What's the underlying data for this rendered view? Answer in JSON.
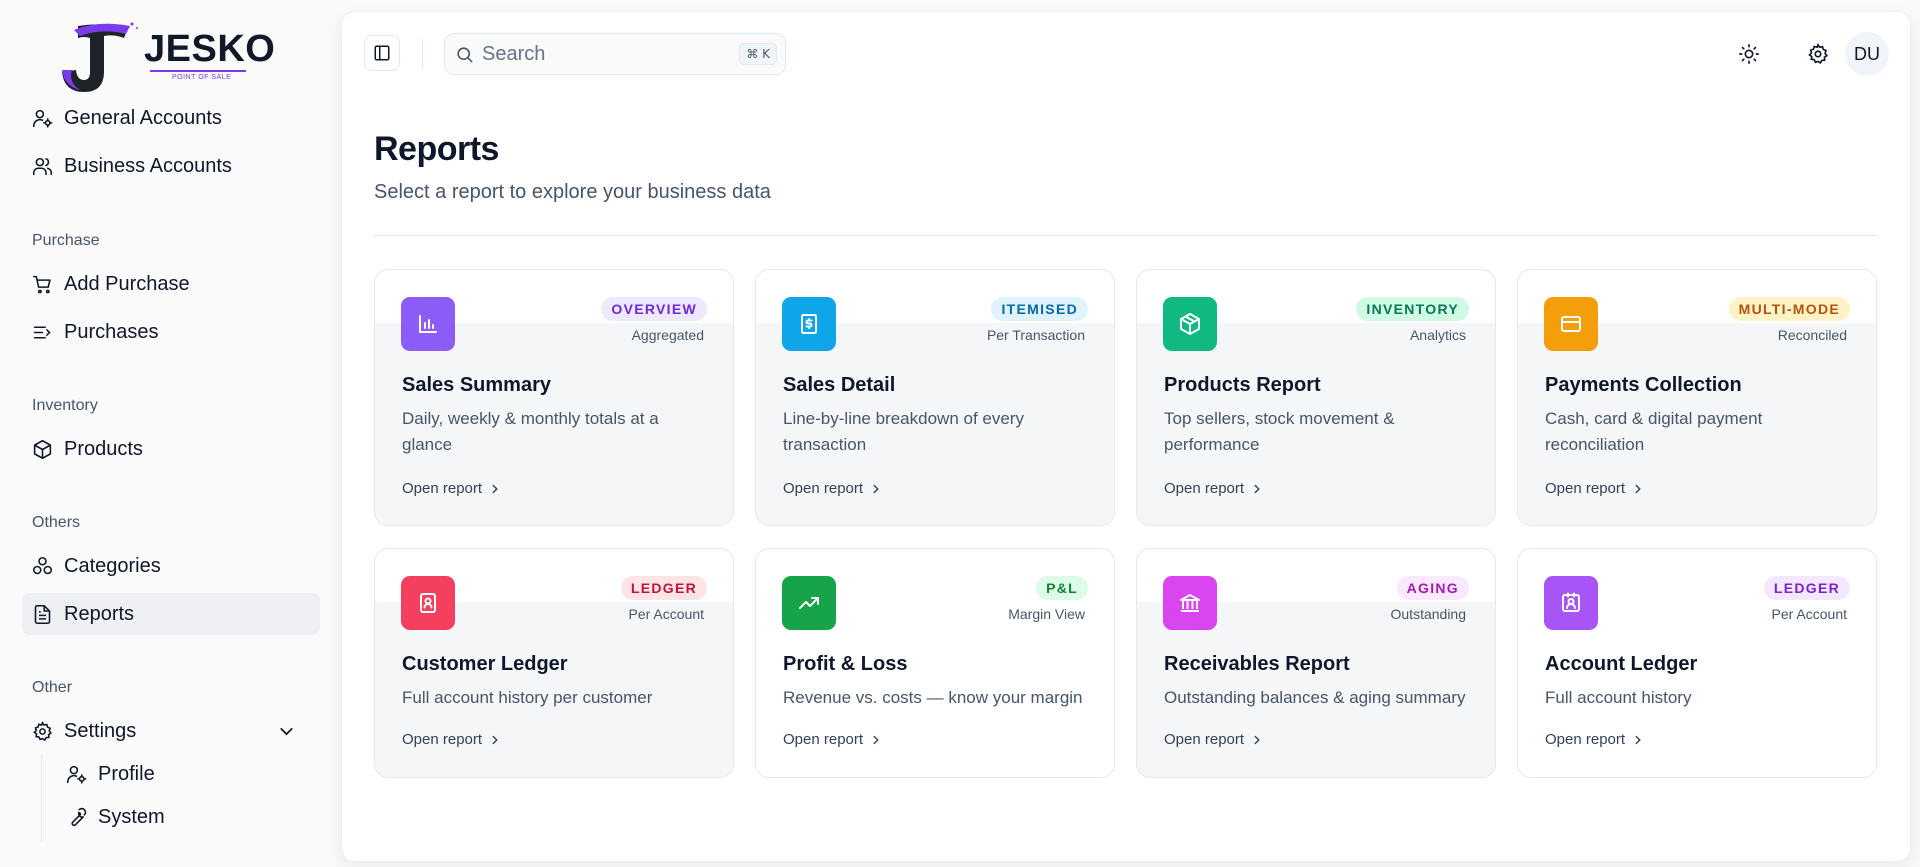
{
  "brand": {
    "name": "JESKO",
    "tagline": "POINT OF SALE",
    "accent": "#7c3aed"
  },
  "sidebar": {
    "top_items": [
      {
        "label": "General Accounts",
        "icon": "user-cog-icon"
      },
      {
        "label": "Business Accounts",
        "icon": "users-icon"
      }
    ],
    "sections": [
      {
        "title": "Purchase",
        "items": [
          {
            "label": "Add Purchase",
            "icon": "cart-icon"
          },
          {
            "label": "Purchases",
            "icon": "list-icon"
          }
        ]
      },
      {
        "title": "Inventory",
        "items": [
          {
            "label": "Products",
            "icon": "box-icon"
          }
        ]
      },
      {
        "title": "Others",
        "items": [
          {
            "label": "Categories",
            "icon": "categories-icon"
          },
          {
            "label": "Reports",
            "icon": "file-text-icon",
            "active": true
          }
        ]
      },
      {
        "title": "Other",
        "items": [
          {
            "label": "Settings",
            "icon": "gear-icon"
          }
        ]
      }
    ],
    "settings_children": [
      {
        "label": "Profile",
        "icon": "user-cog-icon"
      },
      {
        "label": "System",
        "icon": "wrench-icon"
      }
    ]
  },
  "topbar": {
    "search_placeholder": "Search",
    "shortcut": "⌘ K",
    "avatar_initials": "DU"
  },
  "page": {
    "title": "Reports",
    "subtitle": "Select a report to explore your business data"
  },
  "cards": [
    {
      "title": "Sales Summary",
      "desc": "Daily, weekly & monthly totals at a glance",
      "badge": "OVERVIEW",
      "badge_sub": "Aggregated",
      "link": "Open report",
      "icon": "bar-chart-icon",
      "icon_bg": "#8b5cf6",
      "badge_bg": "#ede9fe",
      "badge_fg": "#6d28d9"
    },
    {
      "title": "Sales Detail",
      "desc": "Line-by-line breakdown of every transaction",
      "badge": "ITEMISED",
      "badge_sub": "Per Transaction",
      "link": "Open report",
      "icon": "receipt-dollar-icon",
      "icon_bg": "#0ea5e9",
      "badge_bg": "#e0f2fe",
      "badge_fg": "#0369a1"
    },
    {
      "title": "Products Report",
      "desc": "Top sellers, stock movement & performance",
      "badge": "INVENTORY",
      "badge_sub": "Analytics",
      "link": "Open report",
      "icon": "package-icon",
      "icon_bg": "#10b981",
      "badge_bg": "#d1fae5",
      "badge_fg": "#047857"
    },
    {
      "title": "Payments Collection",
      "desc": "Cash, card & digital payment reconciliation",
      "badge": "MULTI-MODE",
      "badge_sub": "Reconciled",
      "link": "Open report",
      "icon": "credit-card-icon",
      "icon_bg": "#f59e0b",
      "badge_bg": "#fef3c7",
      "badge_fg": "#b45309"
    },
    {
      "title": "Customer Ledger",
      "desc": "Full account history per customer",
      "badge": "LEDGER",
      "badge_sub": "Per Account",
      "link": "Open report",
      "icon": "contact-book-icon",
      "icon_bg": "#f43f5e",
      "badge_bg": "#ffe4e6",
      "badge_fg": "#be123c"
    },
    {
      "title": "Profit & Loss",
      "desc": "Revenue vs. costs — know your margin",
      "badge": "P&L",
      "badge_sub": "Margin View",
      "link": "Open report",
      "icon": "trending-up-icon",
      "icon_bg": "#16a34a",
      "badge_bg": "#dcfce7",
      "badge_fg": "#15803d"
    },
    {
      "title": "Receivables Report",
      "desc": "Outstanding balances & aging summary",
      "badge": "AGING",
      "badge_sub": "Outstanding",
      "link": "Open report",
      "icon": "bank-icon",
      "icon_bg": "#d946ef",
      "badge_bg": "#fae8ff",
      "badge_fg": "#a21caf"
    },
    {
      "title": "Account Ledger",
      "desc": "Full account history",
      "badge": "LEDGER",
      "badge_sub": "Per Account",
      "link": "Open report",
      "icon": "contact-square-icon",
      "icon_bg": "#a855f7",
      "badge_bg": "#f3e8ff",
      "badge_fg": "#7e22ce"
    }
  ]
}
